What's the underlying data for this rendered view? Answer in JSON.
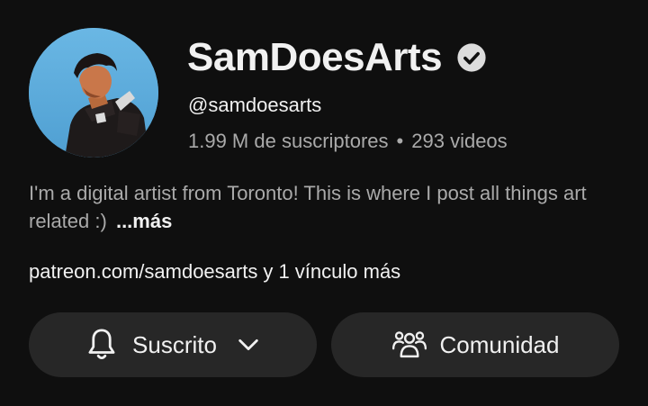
{
  "channel": {
    "name": "SamDoesArts",
    "verified": true,
    "handle": "@samdoesarts",
    "subscribers": "1.99 M de suscriptores",
    "separator": "•",
    "videos": "293 videos"
  },
  "description": {
    "text": "I'm a digital artist from Toronto! This is where I post all things art related :)",
    "more_label": "...más"
  },
  "links": {
    "primary": "patreon.com/samdoesarts",
    "more": "y 1 vínculo más"
  },
  "buttons": {
    "subscribe_label": "Suscrito",
    "subscribe_icon": "bell-icon",
    "dropdown_icon": "chevron-down-icon",
    "community_label": "Comunidad",
    "community_icon": "people-icon"
  },
  "colors": {
    "background": "#0f0f0f",
    "button_background": "#272727",
    "primary_text": "#f1f1f1",
    "secondary_text": "#aaaaaa",
    "avatar_sky": "#5aa9d9"
  }
}
